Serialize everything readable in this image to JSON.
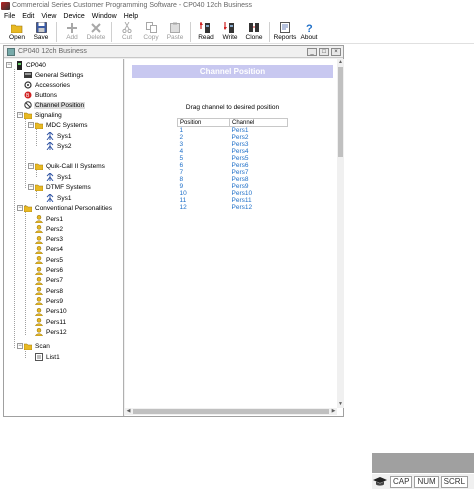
{
  "window": {
    "title": "Commercial Series Customer Programming Software - CP040 12ch Business"
  },
  "menu": [
    "File",
    "Edit",
    "View",
    "Device",
    "Window",
    "Help"
  ],
  "toolbar": {
    "open": "Open",
    "save": "Save",
    "add": "Add",
    "delete": "Delete",
    "cut": "Cut",
    "copy": "Copy",
    "paste": "Paste",
    "read": "Read",
    "write": "Write",
    "clone": "Clone",
    "reports": "Reports",
    "about": "About"
  },
  "child": {
    "title": "CP040 12ch Business",
    "minimize": "_",
    "restore": "□",
    "close": "×"
  },
  "tree": {
    "root": "CP040",
    "general": "General Settings",
    "accessories": "Accessories",
    "buttons": "Buttons",
    "channel_position": "Channel Position",
    "signaling": "Signaling",
    "mdc": "MDC Systems",
    "mdc_sys": [
      "Sys1",
      "Sys2"
    ],
    "quikcall": "Quik-Call II Systems",
    "quikcall_sys": [
      "Sys1"
    ],
    "dtmf": "DTMF Systems",
    "dtmf_sys": [
      "Sys1"
    ],
    "personalities": "Conventional Personalities",
    "pers": [
      "Pers1",
      "Pers2",
      "Pers3",
      "Pers4",
      "Pers5",
      "Pers6",
      "Pers7",
      "Pers8",
      "Pers9",
      "Pers10",
      "Pers11",
      "Pers12"
    ],
    "scan": "Scan",
    "scan_lists": [
      "List1"
    ]
  },
  "content": {
    "banner": "Channel Position",
    "instruction": "Drag channel to desired position",
    "columns": [
      "Position",
      "Channel"
    ],
    "rows": [
      [
        "1",
        "Pers1"
      ],
      [
        "2",
        "Pers2"
      ],
      [
        "3",
        "Pers3"
      ],
      [
        "4",
        "Pers4"
      ],
      [
        "5",
        "Pers5"
      ],
      [
        "6",
        "Pers6"
      ],
      [
        "7",
        "Pers7"
      ],
      [
        "8",
        "Pers8"
      ],
      [
        "9",
        "Pers9"
      ],
      [
        "10",
        "Pers10"
      ],
      [
        "11",
        "Pers11"
      ],
      [
        "12",
        "Pers12"
      ]
    ]
  },
  "status": {
    "cap": "CAP",
    "num": "NUM",
    "scrl": "SCRL"
  },
  "colors": {
    "banner": "#c8c8f0",
    "link": "#1e6fc8",
    "selection": "#dcdcdc"
  }
}
